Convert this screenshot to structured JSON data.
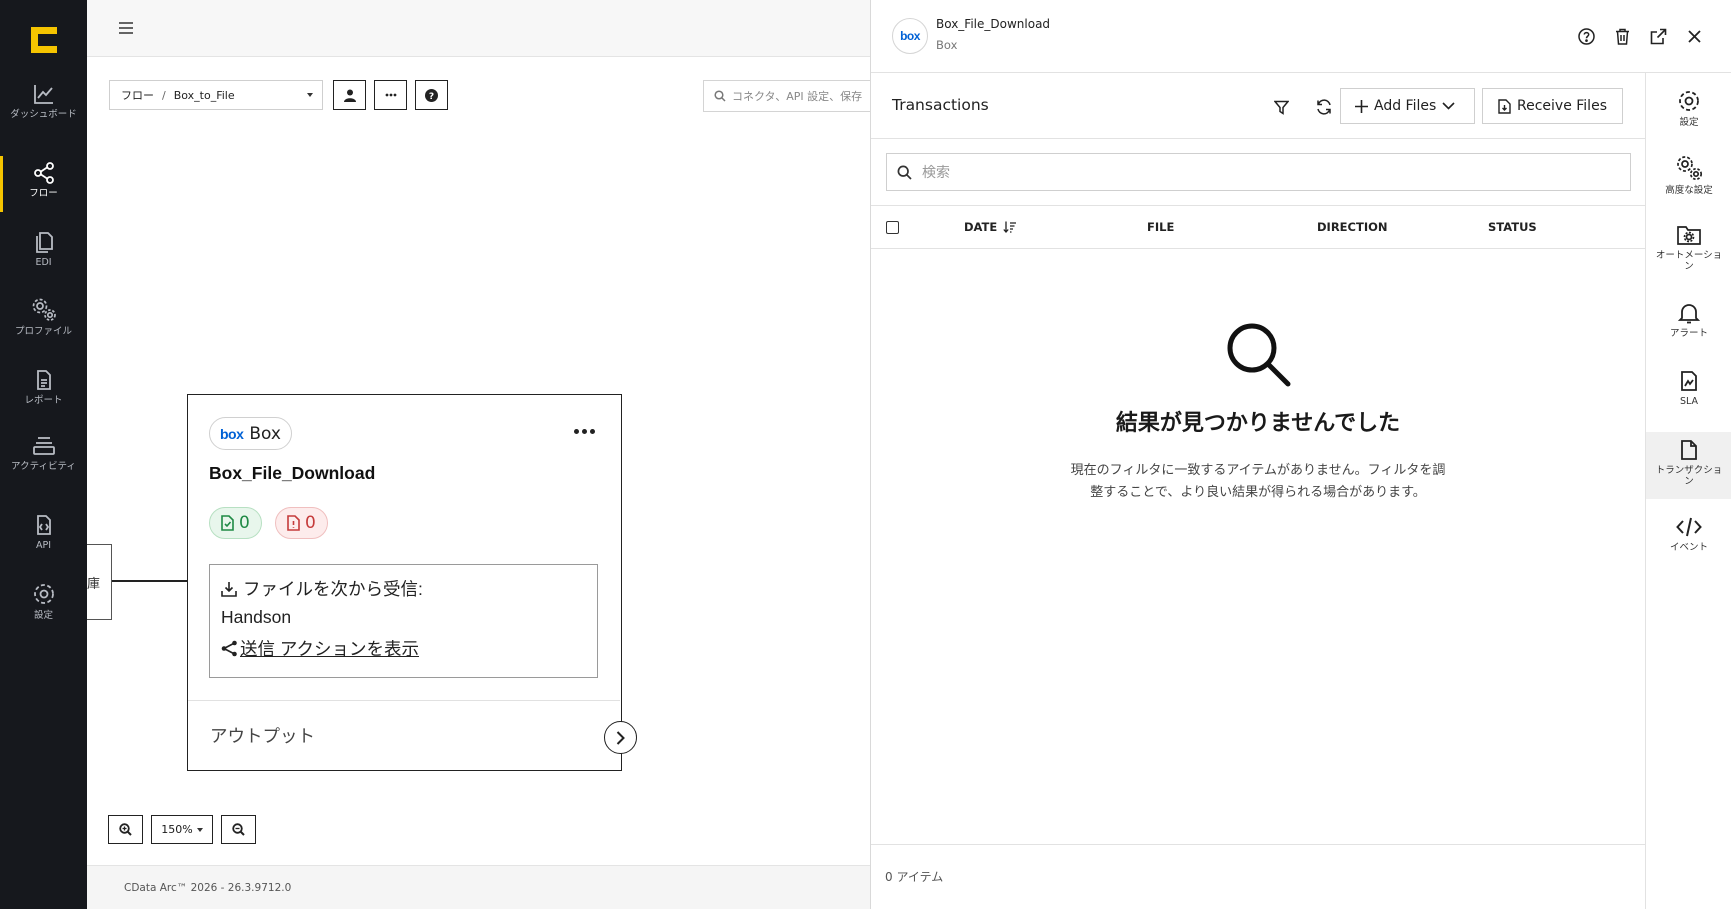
{
  "nav": {
    "items": [
      {
        "label": "ダッシュボード",
        "icon": "chart-line-icon"
      },
      {
        "label": "フロー",
        "icon": "share-nodes-icon"
      },
      {
        "label": "EDI",
        "icon": "files-icon"
      },
      {
        "label": "プロファイル",
        "icon": "gears-icon"
      },
      {
        "label": "レポート",
        "icon": "report-icon"
      },
      {
        "label": "アクティビティ",
        "icon": "layers-icon"
      },
      {
        "label": "API",
        "icon": "api-file-icon"
      },
      {
        "label": "設定",
        "icon": "gear-icon"
      }
    ],
    "active_index": 1,
    "accent_color": "#f5c400"
  },
  "canvas": {
    "breadcrumb": {
      "root": "フロー",
      "separator": "/",
      "current": "Box_to_File"
    },
    "search_placeholder": "コネクタ、API 設定、保存",
    "left_node_text": "庫",
    "card": {
      "chip_logo": "box",
      "chip_label": "Box",
      "title": "Box_File_Download",
      "success_count": "0",
      "error_count": "0",
      "receive_label": "ファイルを次から受信:",
      "receive_source": "Handson",
      "send_actions_link": "送信 アクションを表示",
      "output_label": "アウトプット"
    },
    "zoom_level": "150%",
    "footer_version": "CData Arc™ 2026 - 26.3.9712.0"
  },
  "drawer": {
    "logo": "box",
    "title": "Box_File_Download",
    "subtitle": "Box",
    "transactions": {
      "title": "Transactions",
      "add_files_label": "Add Files",
      "receive_files_label": "Receive Files",
      "search_placeholder": "検索",
      "columns": [
        "DATE",
        "FILE",
        "DIRECTION",
        "STATUS"
      ],
      "empty_title": "結果が見つかりませんでした",
      "empty_description": "現在のフィルタに一致するアイテムがありません。フィルタを調整することで、より良い結果が得られる場合があります。",
      "item_count": "0 アイテム"
    },
    "rail": [
      {
        "label": "設定",
        "icon": "gear-icon"
      },
      {
        "label": "高度な設定",
        "icon": "gears-icon"
      },
      {
        "label": "オートメーション",
        "icon": "folder-gear-icon"
      },
      {
        "label": "アラート",
        "icon": "bell-icon"
      },
      {
        "label": "SLA",
        "icon": "sla-file-icon"
      },
      {
        "label": "トランザクション",
        "icon": "file-icon"
      },
      {
        "label": "イベント",
        "icon": "code-icon"
      }
    ],
    "rail_active_index": 5
  }
}
